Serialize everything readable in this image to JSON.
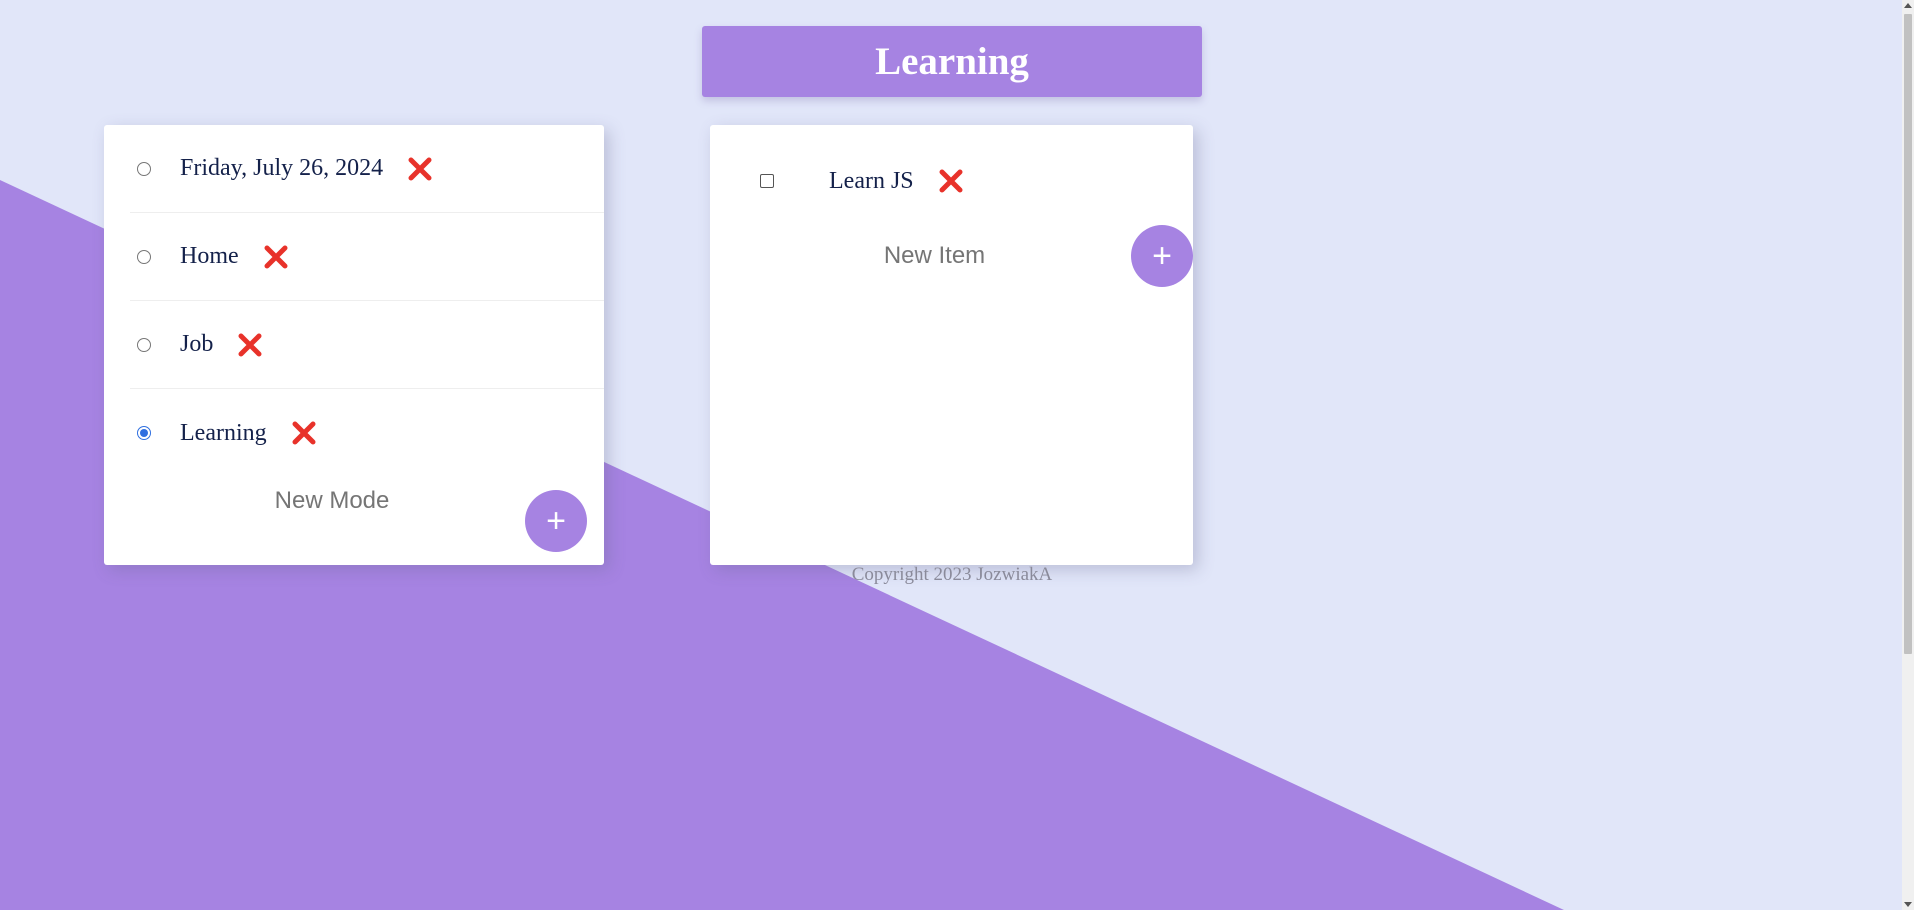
{
  "colors": {
    "background": "#E1E6F9",
    "accent": "#A683E2",
    "card": "#FFFFFF",
    "text": "#14214A",
    "delete": "#E8322A",
    "radio_selected": "#2F6FE0"
  },
  "header": {
    "title": "Learning"
  },
  "modes": {
    "items": [
      {
        "label": "Friday, July 26, 2024",
        "selected": false,
        "delete_icon": "red-x-icon"
      },
      {
        "label": "Home",
        "selected": false,
        "delete_icon": "red-x-icon"
      },
      {
        "label": "Job",
        "selected": false,
        "delete_icon": "red-x-icon"
      },
      {
        "label": "Learning",
        "selected": true,
        "delete_icon": "red-x-icon"
      }
    ],
    "new_placeholder": "New Mode",
    "add_label": "+"
  },
  "todo": {
    "items": [
      {
        "label": "Learn JS",
        "checked": false,
        "delete_icon": "red-x-icon"
      }
    ],
    "new_placeholder": "New Item",
    "add_label": "+"
  },
  "footer": {
    "copyright": "Copyright 2023 JozwiakA"
  }
}
